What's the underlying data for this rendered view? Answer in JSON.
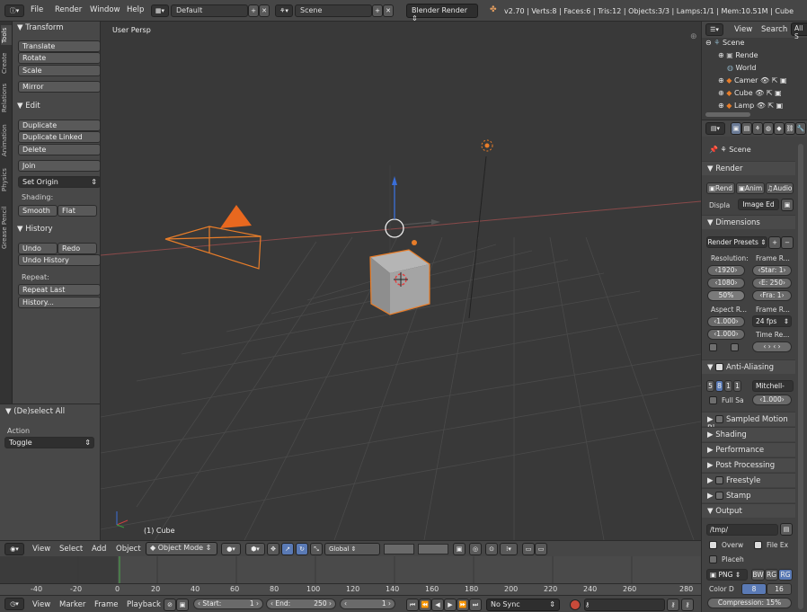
{
  "topbar": {
    "menus": [
      "File",
      "Render",
      "Window",
      "Help"
    ],
    "layout": "Default",
    "scene": "Scene",
    "engine": "Blender Render",
    "status": "v2.70 | Verts:8 | Faces:6 | Tris:12 | Objects:3/3 | Lamps:1/1 | Mem:10.51M | Cube"
  },
  "tabs": [
    "Tools",
    "Create",
    "Relations",
    "Animation",
    "Physics",
    "Grease Pencil"
  ],
  "tools": {
    "transform": "Transform",
    "translate": "Translate",
    "rotate": "Rotate",
    "scale": "Scale",
    "mirror": "Mirror",
    "edit": "Edit",
    "duplicate": "Duplicate",
    "duplicate_linked": "Duplicate Linked",
    "delete": "Delete",
    "join": "Join",
    "set_origin": "Set Origin",
    "shading": "Shading:",
    "smooth": "Smooth",
    "flat": "Flat",
    "history": "History",
    "undo": "Undo",
    "redo": "Redo",
    "undo_history": "Undo History",
    "repeat": "Repeat:",
    "repeat_last": "Repeat Last",
    "history_dots": "History..."
  },
  "operator": {
    "title": "(De)select All",
    "action_label": "Action",
    "action": "Toggle"
  },
  "viewport": {
    "label": "User Persp",
    "object": "(1) Cube"
  },
  "viewheader": {
    "view": "View",
    "select": "Select",
    "add": "Add",
    "object": "Object",
    "mode": "Object Mode",
    "orientation": "Global"
  },
  "ruler": [
    "-40",
    "-20",
    "0",
    "20",
    "40",
    "60",
    "80",
    "100",
    "120",
    "140",
    "160",
    "180",
    "200",
    "220",
    "240",
    "260",
    "280"
  ],
  "timeheader": {
    "view": "View",
    "marker": "Marker",
    "frame": "Frame",
    "playback": "Playback",
    "start_label": "Start:",
    "start": "1",
    "end_label": "End:",
    "end": "250",
    "current": "1",
    "sync": "No Sync"
  },
  "outliner": {
    "view": "View",
    "search": "Search",
    "all": "All S",
    "items": [
      "Scene",
      "Rende",
      "World",
      "Camer",
      "Cube",
      "Lamp"
    ]
  },
  "props": {
    "scene": "Scene",
    "render": "Render",
    "render_btn": "Rend",
    "anim_btn": "Anim",
    "audio_btn": "Audio",
    "display_label": "Displa",
    "display": "Image Ed",
    "dimensions": "Dimensions",
    "render_presets": "Render Presets",
    "resolution": "Resolution:",
    "res_x": "1920",
    "res_y": "1080",
    "res_pct": "50%",
    "frame_range": "Frame R...",
    "start": "Star: 1",
    "end": "E: 250",
    "frame_step": "Fra: 1",
    "aspect": "Aspect R...",
    "aspect_x": "1.000",
    "aspect_y": "1.000",
    "frame_rate": "Frame R...",
    "fps": "24 fps",
    "time_remap": "Time Re...",
    "anti_aliasing": "Anti-Aliasing",
    "aa_5": "5",
    "aa_8": "8",
    "aa_11": "1",
    "aa_16": "1",
    "aa_filter": "Mitchell-",
    "full_sample": "Full Sa",
    "filter_size": "1.000",
    "motion_blur": "Sampled Motion Bl",
    "shading": "Shading",
    "performance": "Performance",
    "post_processing": "Post Processing",
    "freestyle": "Freestyle",
    "stamp": "Stamp",
    "output": "Output",
    "path": "/tmp/",
    "overwrite": "Overw",
    "file_ext": "File Ex",
    "placeholders": "Placeh",
    "format": "PNG",
    "bw": "BW",
    "rgb": "RG",
    "rgba": "RG",
    "color_depth_label": "Color D",
    "depth8": "8",
    "depth16": "16",
    "compression": "Compression:   15%"
  }
}
